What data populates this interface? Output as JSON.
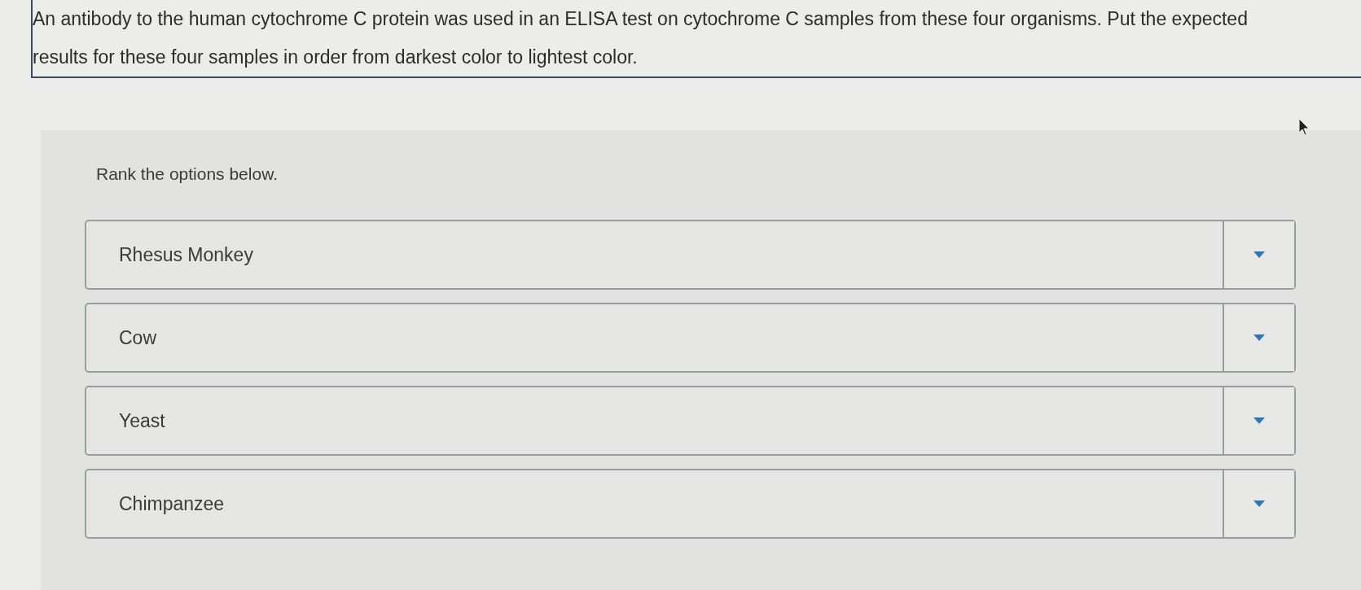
{
  "question": {
    "text": "An antibody to the human cytochrome C protein was used in an ELISA test on cytochrome C samples from these four organisms. Put the expected results for these four samples in order from darkest color to lightest color."
  },
  "ranking": {
    "instruction": "Rank the options below.",
    "options": [
      {
        "label": "Rhesus Monkey"
      },
      {
        "label": "Cow"
      },
      {
        "label": "Yeast"
      },
      {
        "label": "Chimpanzee"
      }
    ]
  }
}
